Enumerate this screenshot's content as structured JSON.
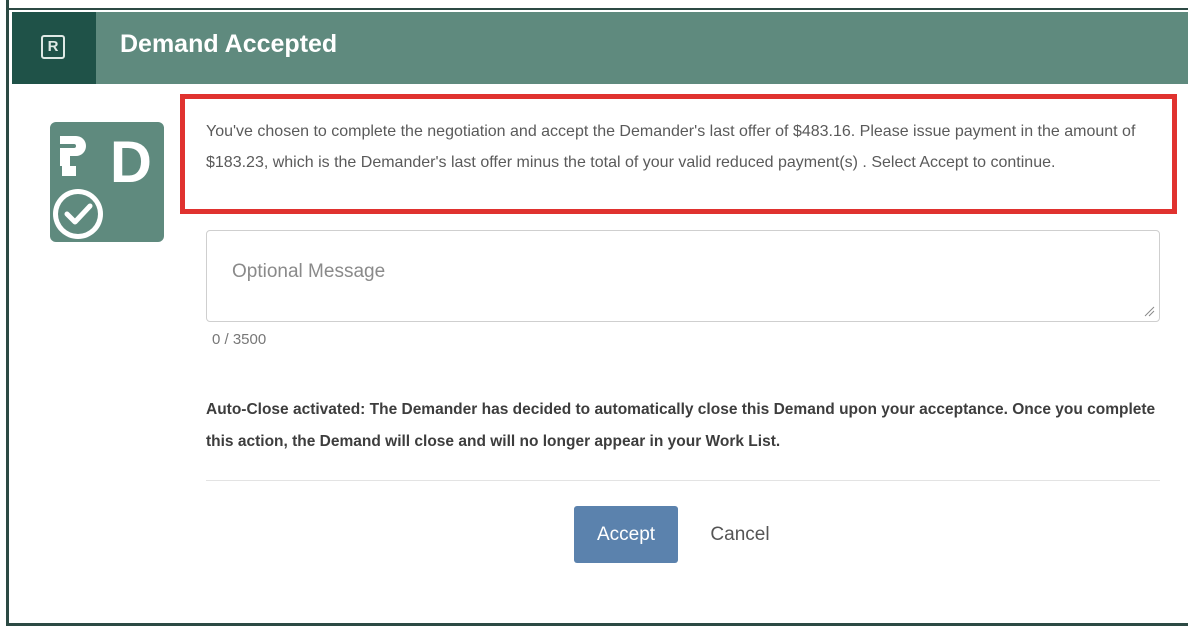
{
  "dialog": {
    "title": "Demand Accepted",
    "logo_letter": "R"
  },
  "status_icon": {
    "letter": "D",
    "icon_name": "demand-accepted-check-icon",
    "color": "#5f8a7e"
  },
  "info": {
    "text": "You've chosen to complete the negotiation and accept the Demander's last offer of $483.16. Please issue payment in the amount of $183.23, which is the Demander's last offer minus the total of your valid reduced payment(s) . Select Accept to continue.",
    "highlight_color": "#e0322f"
  },
  "message": {
    "placeholder": "Optional Message",
    "value": "",
    "counter": "0 / 3500"
  },
  "autoclose": {
    "text": "Auto-Close activated: The Demander has decided to automatically close this Demand upon your acceptance. Once you complete this action, the Demand will close and will no longer appear in your Work List."
  },
  "actions": {
    "accept_label": "Accept",
    "cancel_label": "Cancel",
    "accept_color": "#5b82ad"
  },
  "theme": {
    "header_color": "#5f8a7e",
    "logo_tile_color": "#1f5248"
  }
}
